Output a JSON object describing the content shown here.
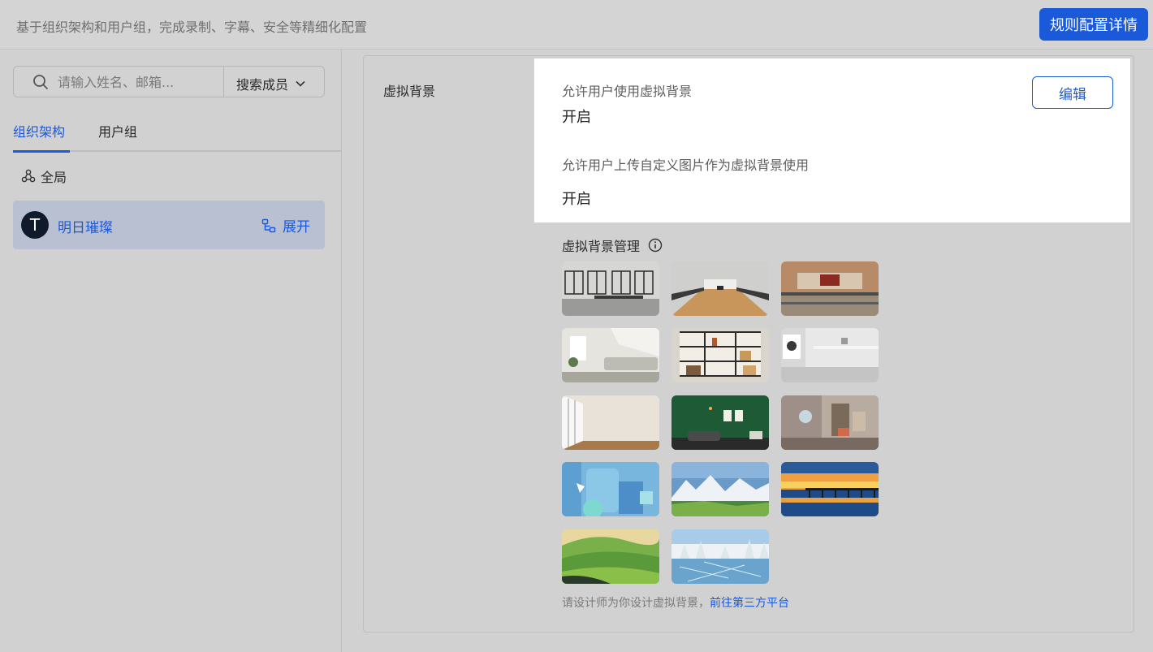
{
  "header": {
    "description": "基于组织架构和用户组，完成录制、字幕、安全等精细化配置",
    "detail_button": "规则配置详情"
  },
  "sidebar": {
    "search_placeholder": "请输入姓名、邮箱...",
    "search_scope": "搜索成员",
    "tabs": [
      {
        "label": "组织架构",
        "active": true
      },
      {
        "label": "用户组",
        "active": false
      }
    ],
    "global_label": "全局",
    "org": {
      "avatar_letter": "T",
      "name": "明日璀璨",
      "expand_label": "展开"
    }
  },
  "main": {
    "section_label": "虚拟背景",
    "settings": [
      {
        "label": "允许用户使用虚拟背景",
        "value": "开启"
      },
      {
        "label": "允许用户上传自定义图片作为虚拟背景使用",
        "value": "开启"
      }
    ],
    "edit_button": "编辑",
    "management_label": "虚拟背景管理",
    "backgrounds": [
      {
        "name": "bright-office-windows"
      },
      {
        "name": "long-conference-hall"
      },
      {
        "name": "meeting-room-wood"
      },
      {
        "name": "loft-living-room"
      },
      {
        "name": "bookshelf-wall"
      },
      {
        "name": "minimal-gray-room"
      },
      {
        "name": "empty-room-windows"
      },
      {
        "name": "green-wall-lounge"
      },
      {
        "name": "modern-living-room"
      },
      {
        "name": "abstract-blue-shapes"
      },
      {
        "name": "snow-mountains-meadow"
      },
      {
        "name": "sunset-pier"
      },
      {
        "name": "green-hills"
      },
      {
        "name": "frozen-lake-forest"
      }
    ],
    "footer_text": "请设计师为你设计虚拟背景，",
    "footer_link": "前往第三方平台"
  },
  "colors": {
    "accent": "#1a59d9",
    "selected_bg": "#b9c0d1"
  }
}
